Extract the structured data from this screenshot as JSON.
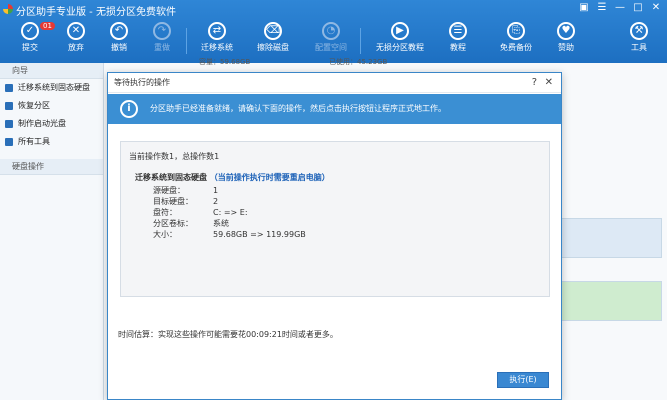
{
  "app": {
    "title": "分区助手专业版 - 无损分区免费软件"
  },
  "window_controls": [
    "▣",
    "☰",
    "—",
    "□",
    "✕"
  ],
  "toolbar": {
    "badge": "01",
    "buttons": [
      {
        "label": "提交",
        "icon": "✓"
      },
      {
        "label": "放弃",
        "icon": "✕"
      },
      {
        "label": "撤销",
        "icon": "↶"
      },
      {
        "label": "重做",
        "icon": "↷"
      },
      {
        "label": "迁移系统",
        "icon": "⇄"
      },
      {
        "label": "擦除磁盘",
        "icon": "⌫"
      },
      {
        "label": "配置空间",
        "icon": "◔"
      },
      {
        "label": "无损分区教程",
        "icon": "▶"
      },
      {
        "label": "教程",
        "icon": "☰"
      },
      {
        "label": "免费备份",
        "icon": "⎘"
      },
      {
        "label": "赞助",
        "icon": "♥"
      },
      {
        "label": "工具",
        "icon": "⚒"
      }
    ]
  },
  "sidebar": {
    "wizard_header": "向导",
    "items": [
      {
        "label": "迁移系统到固态硬盘"
      },
      {
        "label": "恢复分区"
      },
      {
        "label": "制作启动光盘"
      },
      {
        "label": "所有工具"
      }
    ],
    "disk_header": "硬盘操作"
  },
  "background": {
    "capacity_label": "容量：59.68GB",
    "used_label": "已使用：45.23GB"
  },
  "dialog": {
    "title": "等待执行的操作",
    "help": "?",
    "close": "✕",
    "banner": "分区助手已经准备就绪，请确认下面的操作，然后点击执行按钮让程序正式地工作。",
    "op_count": "当前操作数1，总操作数1",
    "op_title": "迁移系统到固态硬盘",
    "op_note": "（当前操作执行时需要重启电脑）",
    "details": [
      {
        "key": "源硬盘：",
        "value": "1"
      },
      {
        "key": "目标硬盘：",
        "value": "2"
      },
      {
        "key": "盘符：",
        "value": "C: => E:"
      },
      {
        "key": "分区卷标：",
        "value": "系统"
      },
      {
        "key": "大小：",
        "value": "59.68GB => 119.99GB"
      }
    ],
    "time_estimate": "时间估算：实现这些操作可能需要花00:09:21时间或者更多。",
    "execute_button": "执行(E)"
  }
}
